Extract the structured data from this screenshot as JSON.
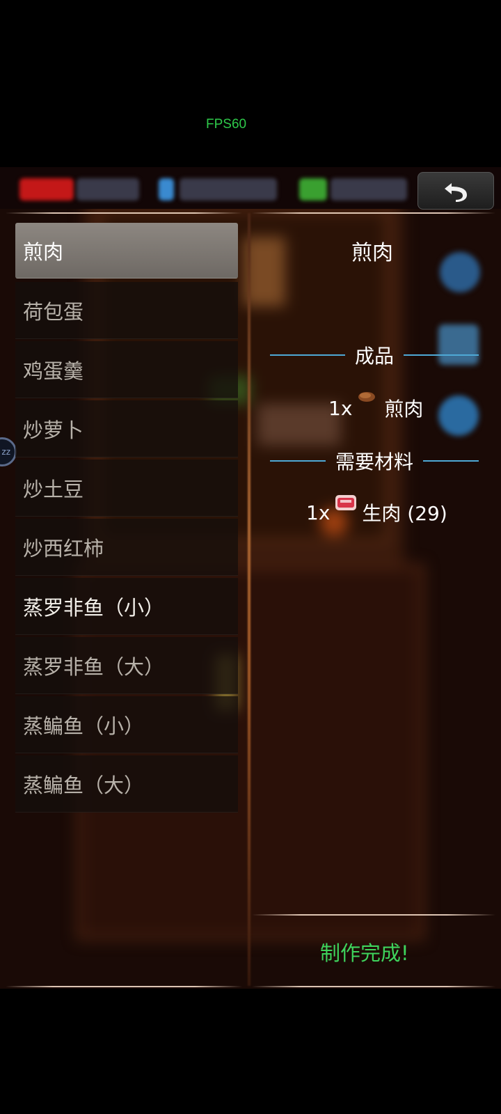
{
  "fps_label": "FPS60",
  "hud": {
    "back_icon": "undo-arrow-icon"
  },
  "recipes": [
    {
      "label": "煎肉",
      "state": "selected"
    },
    {
      "label": "荷包蛋",
      "state": "normal"
    },
    {
      "label": "鸡蛋羹",
      "state": "normal"
    },
    {
      "label": "炒萝卜",
      "state": "normal"
    },
    {
      "label": "炒土豆",
      "state": "normal"
    },
    {
      "label": "炒西红柿",
      "state": "normal"
    },
    {
      "label": "蒸罗非鱼（小）",
      "state": "available"
    },
    {
      "label": "蒸罗非鱼（大）",
      "state": "normal"
    },
    {
      "label": "蒸鳊鱼（小）",
      "state": "normal"
    },
    {
      "label": "蒸鳊鱼（大）",
      "state": "normal"
    }
  ],
  "detail": {
    "title": "煎肉",
    "product_header": "成品",
    "product": {
      "qty": "1x",
      "name": "煎肉",
      "icon": "cooked-meat-icon"
    },
    "materials_header": "需要材料",
    "materials": [
      {
        "qty": "1x",
        "name": "生肉 (29)",
        "icon": "raw-meat-icon"
      }
    ],
    "status": "制作完成!"
  },
  "side_badge": "zz",
  "colors": {
    "section_line": "#4ea9d6",
    "status_green": "#3ed35c",
    "fps_green": "#2ec94a"
  }
}
